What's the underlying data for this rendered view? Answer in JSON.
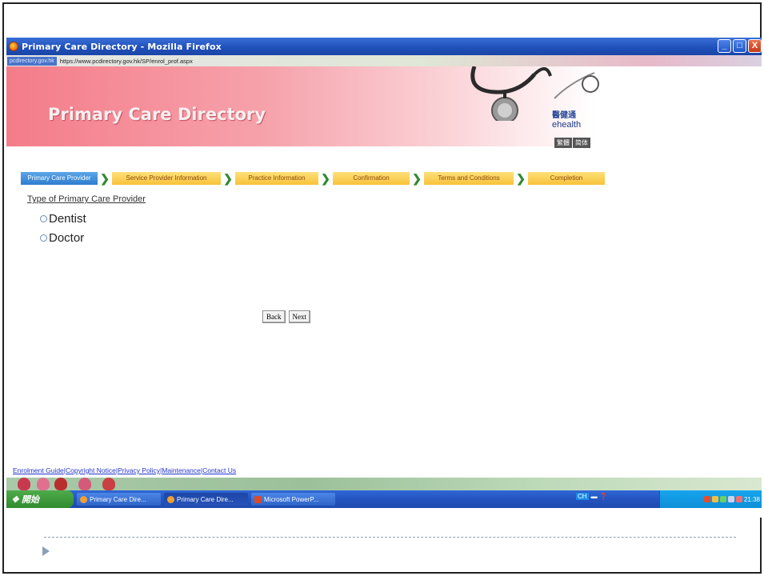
{
  "window": {
    "title": "Primary Care Directory - Mozilla Firefox",
    "controls": {
      "minimize": "_",
      "maximize": "□",
      "close": "X"
    }
  },
  "address": {
    "site_badge": "pcdirectory.gov.hk",
    "url": "https://www.pcdirectory.gov.hk/SP/enrol_prof.aspx"
  },
  "banner": {
    "title": "Primary Care Directory",
    "ehealth_cn": "醫健通",
    "ehealth_en": "ehealth",
    "lang_traditional": "繁體",
    "lang_simplified": "简体"
  },
  "steps": [
    {
      "label": "Primary Care Provider",
      "active": true
    },
    {
      "label": "Service Provider Information",
      "active": false
    },
    {
      "label": "Practice Information",
      "active": false
    },
    {
      "label": "Confirmation",
      "active": false
    },
    {
      "label": "Terms and Conditions",
      "active": false
    },
    {
      "label": "Completion",
      "active": false
    }
  ],
  "form": {
    "section_label": "Type of Primary Care Provider",
    "options": [
      "Dentist",
      "Doctor"
    ],
    "back_label": "Back",
    "next_label": "Next"
  },
  "footer": {
    "links": [
      "Enrolment Guide",
      "Copyright Notice",
      "Privacy Policy",
      "Maintenance",
      "Contact Us"
    ]
  },
  "taskbar": {
    "start_label": "開始",
    "items": [
      {
        "label": "Primary Care Dire...",
        "icon": "firefox-icon",
        "active": false
      },
      {
        "label": "Primary Care Dire...",
        "icon": "firefox-icon",
        "active": true
      },
      {
        "label": "Microsoft PowerP...",
        "icon": "powerpoint-icon",
        "active": false
      }
    ],
    "lang_indicator": "CH",
    "clock": "21:38"
  },
  "colors": {
    "titlebar": "#2a5cc8",
    "active_step": "#2f7ccf",
    "step": "#f7c23a",
    "chevron": "#2e8a2e",
    "banner_pink": "#f47c89",
    "link": "#2233cc"
  }
}
